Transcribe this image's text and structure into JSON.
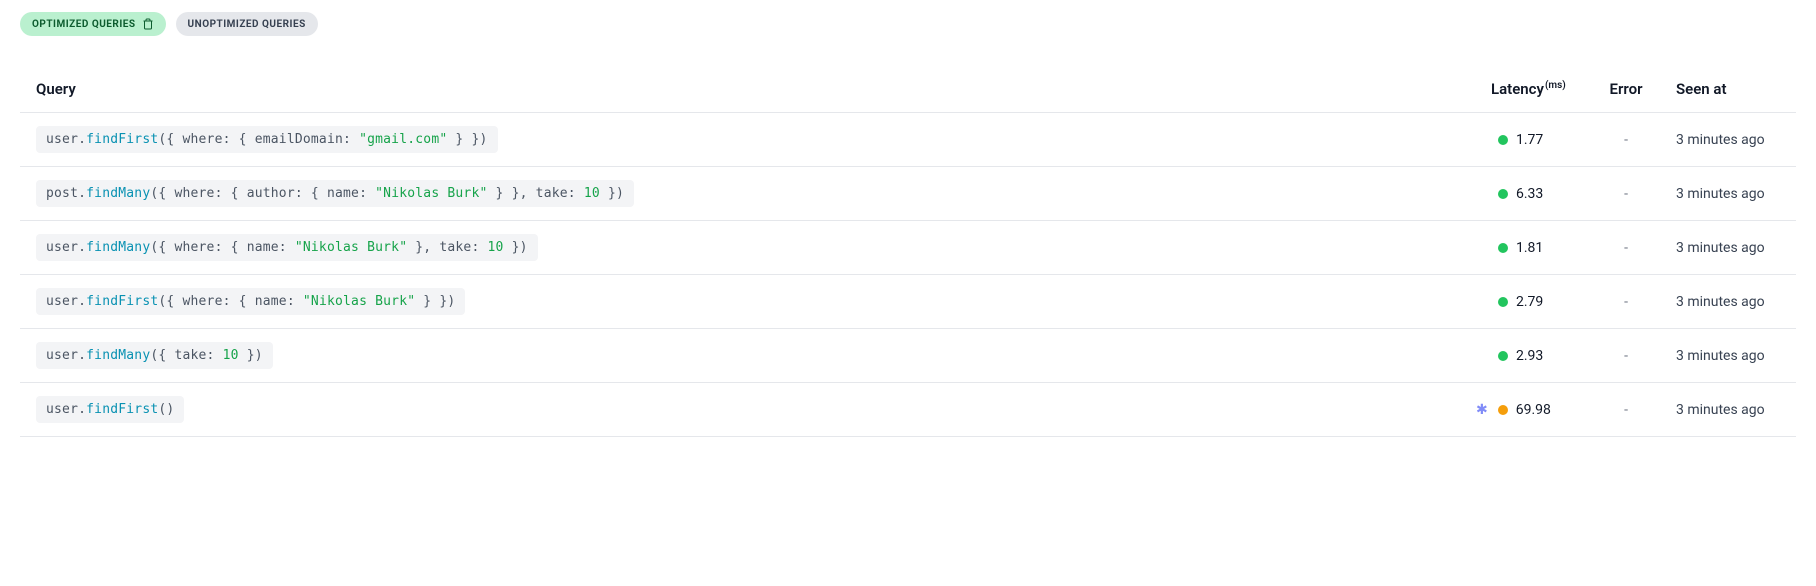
{
  "tabs": {
    "optimized": "OPTIMIZED QUERIES",
    "unoptimized": "UNOPTIMIZED QUERIES"
  },
  "headers": {
    "query": "Query",
    "latency": "Latency",
    "latency_unit": "(ms)",
    "error": "Error",
    "seen_at": "Seen at"
  },
  "rows": [
    {
      "model": "user",
      "method": "findFirst",
      "args_open": "({ where",
      "colon1": ":",
      "args_mid1": " { emailDomain",
      "colon2": ":",
      "str1": " \"gmail.com\"",
      "args_close": " } })",
      "latency": "1.77",
      "status": "green",
      "star": false,
      "error": "-",
      "seen": "3 minutes ago"
    },
    {
      "model": "post",
      "method": "findMany",
      "args_open": "({ where",
      "colon1": ":",
      "args_mid1": " { author",
      "colon2": ":",
      "args_mid2": " { name",
      "colon3": ":",
      "str1": " \"Nikolas Burk\"",
      "args_mid3": " } }, take",
      "colon4": ":",
      "num1": " 10",
      "args_close": " })",
      "latency": "6.33",
      "status": "green",
      "star": false,
      "error": "-",
      "seen": "3 minutes ago"
    },
    {
      "model": "user",
      "method": "findMany",
      "args_open": "({ where",
      "colon1": ":",
      "args_mid1": " { name",
      "colon2": ":",
      "str1": " \"Nikolas Burk\"",
      "args_mid2": " }, take",
      "colon3": ":",
      "num1": " 10",
      "args_close": " })",
      "latency": "1.81",
      "status": "green",
      "star": false,
      "error": "-",
      "seen": "3 minutes ago"
    },
    {
      "model": "user",
      "method": "findFirst",
      "args_open": "({ where",
      "colon1": ":",
      "args_mid1": " { name",
      "colon2": ":",
      "str1": " \"Nikolas Burk\"",
      "args_close": " } })",
      "latency": "2.79",
      "status": "green",
      "star": false,
      "error": "-",
      "seen": "3 minutes ago"
    },
    {
      "model": "user",
      "method": "findMany",
      "args_open": "({ take",
      "colon1": ":",
      "num1": " 10",
      "args_close": " })",
      "latency": "2.93",
      "status": "green",
      "star": false,
      "error": "-",
      "seen": "3 minutes ago"
    },
    {
      "model": "user",
      "method": "findFirst",
      "args_open": "()",
      "latency": "69.98",
      "status": "orange",
      "star": true,
      "error": "-",
      "seen": "3 minutes ago"
    }
  ]
}
